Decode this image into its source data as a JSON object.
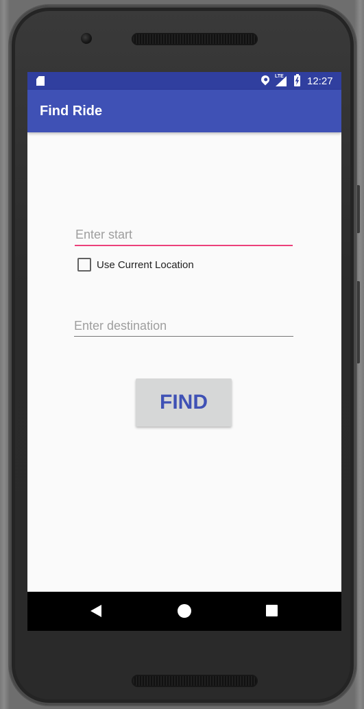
{
  "status_bar": {
    "time": "12:27",
    "lte_label": "LTE",
    "icons": [
      "sd-card-icon",
      "location-icon",
      "lte-signal-icon",
      "battery-charging-icon"
    ]
  },
  "app_bar": {
    "title": "Find Ride",
    "color": "#3f51b5",
    "status_color": "#303f9f"
  },
  "form": {
    "start_placeholder": "Enter start",
    "start_value": "",
    "use_current_location_label": "Use Current Location",
    "use_current_location_checked": false,
    "destination_placeholder": "Enter destination",
    "destination_value": "",
    "find_button_label": "FIND",
    "accent_color": "#ec407a"
  },
  "nav_bar": {
    "icons": [
      "back-icon",
      "home-icon",
      "recents-icon"
    ]
  }
}
